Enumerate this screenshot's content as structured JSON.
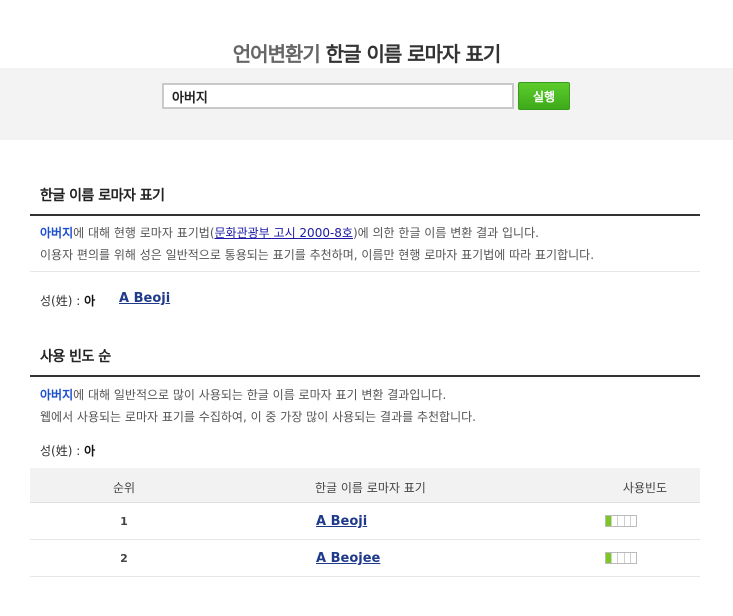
{
  "header": {
    "title_sub": "언어변환기",
    "title_main": "한글 이름 로마자 표기",
    "search_value": "아버지",
    "search_button": "실행"
  },
  "section1": {
    "title": "한글 이름 로마자 표기",
    "line1_name": "아버지",
    "line1_pre": "에 대해 현행 로마자 표기법(",
    "line1_link": "문화관광부 고시 2000-8호",
    "line1_post": ")에 의한 한글 이름 변환 결과 입니다.",
    "line2": "이용자 편의를 위해 성은 일반적으로 통용되는 표기를 추천하며, 이름만 현행 로마자 표기법에 따라 표기합니다.",
    "surname_label": "성(姓) : ",
    "surname_value": "아",
    "result": "A Beoji"
  },
  "section2": {
    "title": "사용 빈도 순",
    "line1_name": "아버지",
    "line1_rest": "에 대해 일반적으로 많이 사용되는 한글 이름 로마자 표기 변환 결과입니다.",
    "line2": "웹에서 사용되는 로마자 표기를 수집하여, 이 중 가장 많이 사용되는 결과를 추천합니다.",
    "surname_label": "성(姓) : ",
    "surname_value": "아",
    "table": {
      "headers": [
        "순위",
        "한글 이름 로마자 표기",
        "사용빈도"
      ],
      "rows": [
        {
          "rank": "1",
          "name": "A Beoji",
          "freq_level": 1,
          "freq_max": 5
        },
        {
          "rank": "2",
          "name": "A Beojee",
          "freq_level": 1,
          "freq_max": 5
        }
      ]
    }
  },
  "colors": {
    "accent_green": "#3eaa19",
    "highlight_blue": "#1c4fcf",
    "link_blue": "#1f3a8a",
    "bar_green": "#7cc723"
  }
}
